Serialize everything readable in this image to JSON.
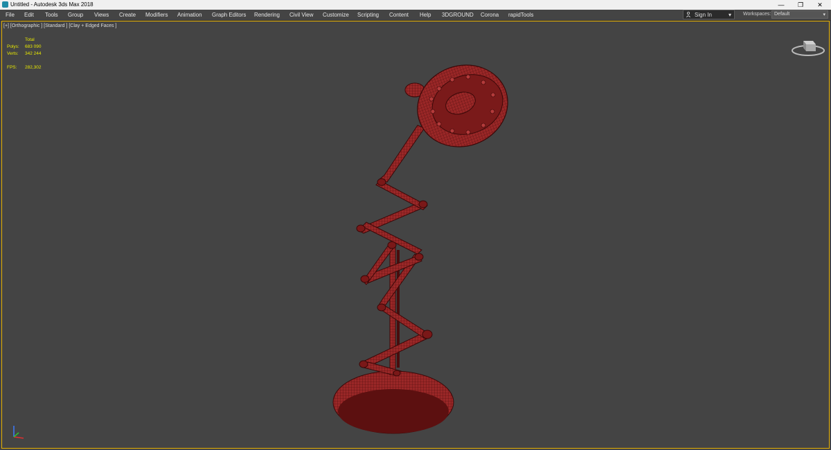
{
  "window": {
    "title": "Untitled - Autodesk 3ds Max 2018",
    "controls": [
      "—",
      "❐",
      "✕"
    ]
  },
  "menu": [
    "File",
    "Edit",
    "Tools",
    "Group",
    "Views",
    "Create",
    "Modifiers",
    "Animation",
    "Graph Editors",
    "Rendering",
    "Civil View",
    "Customize",
    "Scripting",
    "Content",
    "Help",
    "3DGROUND",
    "Corona",
    "rapidTools"
  ],
  "account": {
    "sign_in_label": "Sign In",
    "workspaces_label": "Workspaces:",
    "workspace_value": "Default"
  },
  "viewport": {
    "label": "[+] [Orthographic ] [Standard ] [Clay + Edged Faces ]",
    "stats": {
      "header": "Total",
      "polys_label": "Polys:",
      "polys_value": "683 090",
      "verts_label": "Verts:",
      "verts_value": "342 244",
      "fps_label": "FPS:",
      "fps_value": "282,302"
    }
  },
  "colors": {
    "model": "#8b1f1f",
    "viewport_bg": "#444444",
    "stats_text": "#e8e800",
    "active_border": "#e8b200"
  }
}
